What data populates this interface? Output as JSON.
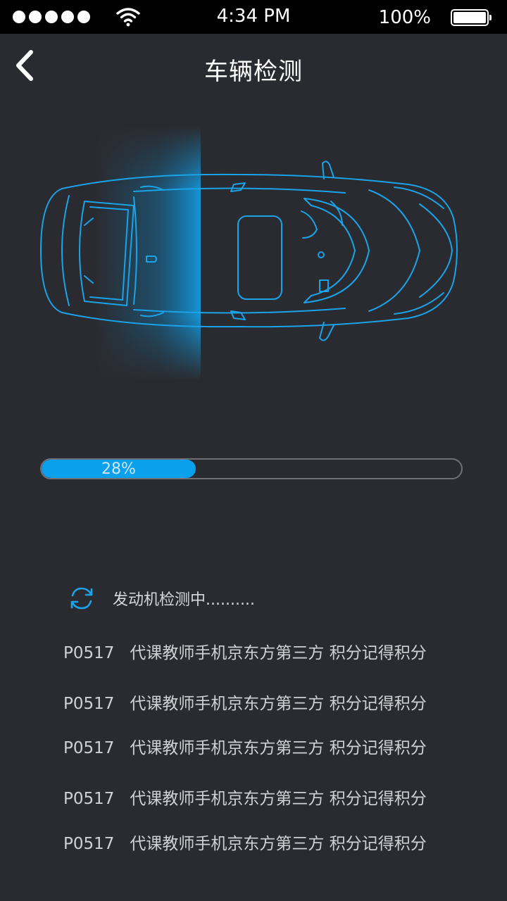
{
  "status_bar": {
    "time": "4:34 PM",
    "battery_percent": "100%",
    "signal_bars": 5,
    "icons": [
      "signal-dots-icon",
      "wifi-icon",
      "battery-icon"
    ]
  },
  "header": {
    "title": "车辆检测",
    "back_icon": "chevron-left-icon"
  },
  "progress": {
    "value": 28,
    "label": "28%"
  },
  "detection": {
    "status_text": "发动机检测中..........",
    "icon": "refresh-icon"
  },
  "codes": [
    {
      "code": "P0517",
      "description": "代课教师手机京东方第三方 积分记得积分"
    },
    {
      "code": "P0517",
      "description": "代课教师手机京东方第三方 积分记得积分"
    },
    {
      "code": "P0517",
      "description": "代课教师手机京东方第三方 积分记得积分"
    },
    {
      "code": "P0517",
      "description": "代课教师手机京东方第三方 积分记得积分"
    },
    {
      "code": "P0517",
      "description": "代课教师手机京东方第三方 积分记得积分"
    }
  ],
  "colors": {
    "background": "#2a2b30",
    "accent": "#0aa0ec",
    "car_outline": "#1aa3e8",
    "text_secondary": "#d0d1d5"
  }
}
